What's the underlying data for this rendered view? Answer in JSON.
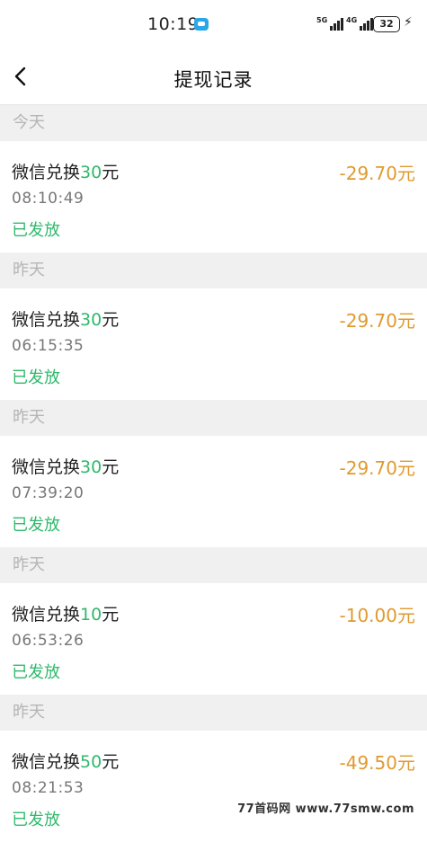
{
  "status_bar": {
    "time": "10:19",
    "network_1": "5G",
    "network_2": "4G",
    "battery": "32"
  },
  "header": {
    "title": "提现记录"
  },
  "sections": [
    {
      "label": "今天"
    },
    {
      "label": "昨天"
    },
    {
      "label": "昨天"
    },
    {
      "label": "昨天"
    },
    {
      "label": "昨天"
    }
  ],
  "records": [
    {
      "prefix": "微信兑换",
      "value": "30",
      "suffix": "元",
      "amount": "-29.70元",
      "time": "08:10:49",
      "status": "已发放"
    },
    {
      "prefix": "微信兑换",
      "value": "30",
      "suffix": "元",
      "amount": "-29.70元",
      "time": "06:15:35",
      "status": "已发放"
    },
    {
      "prefix": "微信兑换",
      "value": "30",
      "suffix": "元",
      "amount": "-29.70元",
      "time": "07:39:20",
      "status": "已发放"
    },
    {
      "prefix": "微信兑换",
      "value": "10",
      "suffix": "元",
      "amount": "-10.00元",
      "time": "06:53:26",
      "status": "已发放"
    },
    {
      "prefix": "微信兑换",
      "value": "50",
      "suffix": "元",
      "amount": "-49.50元",
      "time": "08:21:53",
      "status": "已发放"
    }
  ],
  "watermark": "77首码网 www.77smw.com",
  "colors": {
    "accent_green": "#2fb96b",
    "amount_orange": "#e09a2e",
    "section_bg": "#f0f0f0"
  }
}
